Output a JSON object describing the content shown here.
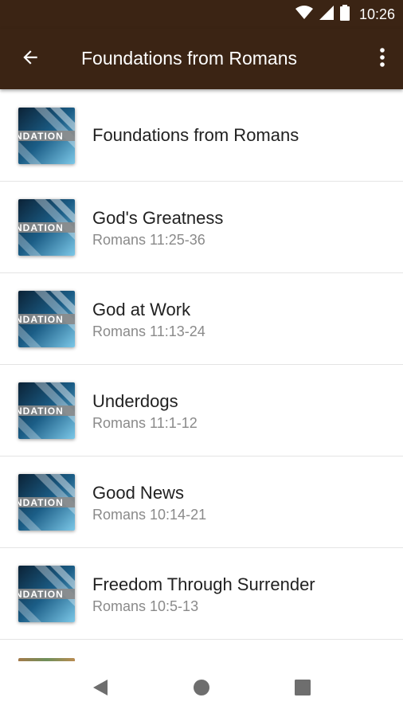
{
  "status_bar": {
    "time": "10:26",
    "icons": [
      "wifi-icon",
      "cell-signal-icon",
      "battery-icon"
    ]
  },
  "app_bar": {
    "title": "Foundations from Romans",
    "back_icon": "arrow-back-icon",
    "menu_icon": "more-vert-icon"
  },
  "items": [
    {
      "title": "Foundations from Romans",
      "subtitle": ""
    },
    {
      "title": "God's Greatness",
      "subtitle": "Romans 11:25-36"
    },
    {
      "title": "God at Work",
      "subtitle": "Romans 11:13-24"
    },
    {
      "title": "Underdogs",
      "subtitle": "Romans 11:1-12"
    },
    {
      "title": "Good News",
      "subtitle": "Romans 10:14-21"
    },
    {
      "title": "Freedom Through Surrender",
      "subtitle": "Romans 10:5-13"
    }
  ],
  "thumbnail": {
    "text": "NDATION"
  },
  "nav_bar": {
    "icons": [
      "back-triangle-icon",
      "home-circle-icon",
      "recents-square-icon"
    ]
  },
  "colors": {
    "app_bar": "#3b2414",
    "title_text": "#212121",
    "subtitle_text": "#8a8a8a"
  }
}
